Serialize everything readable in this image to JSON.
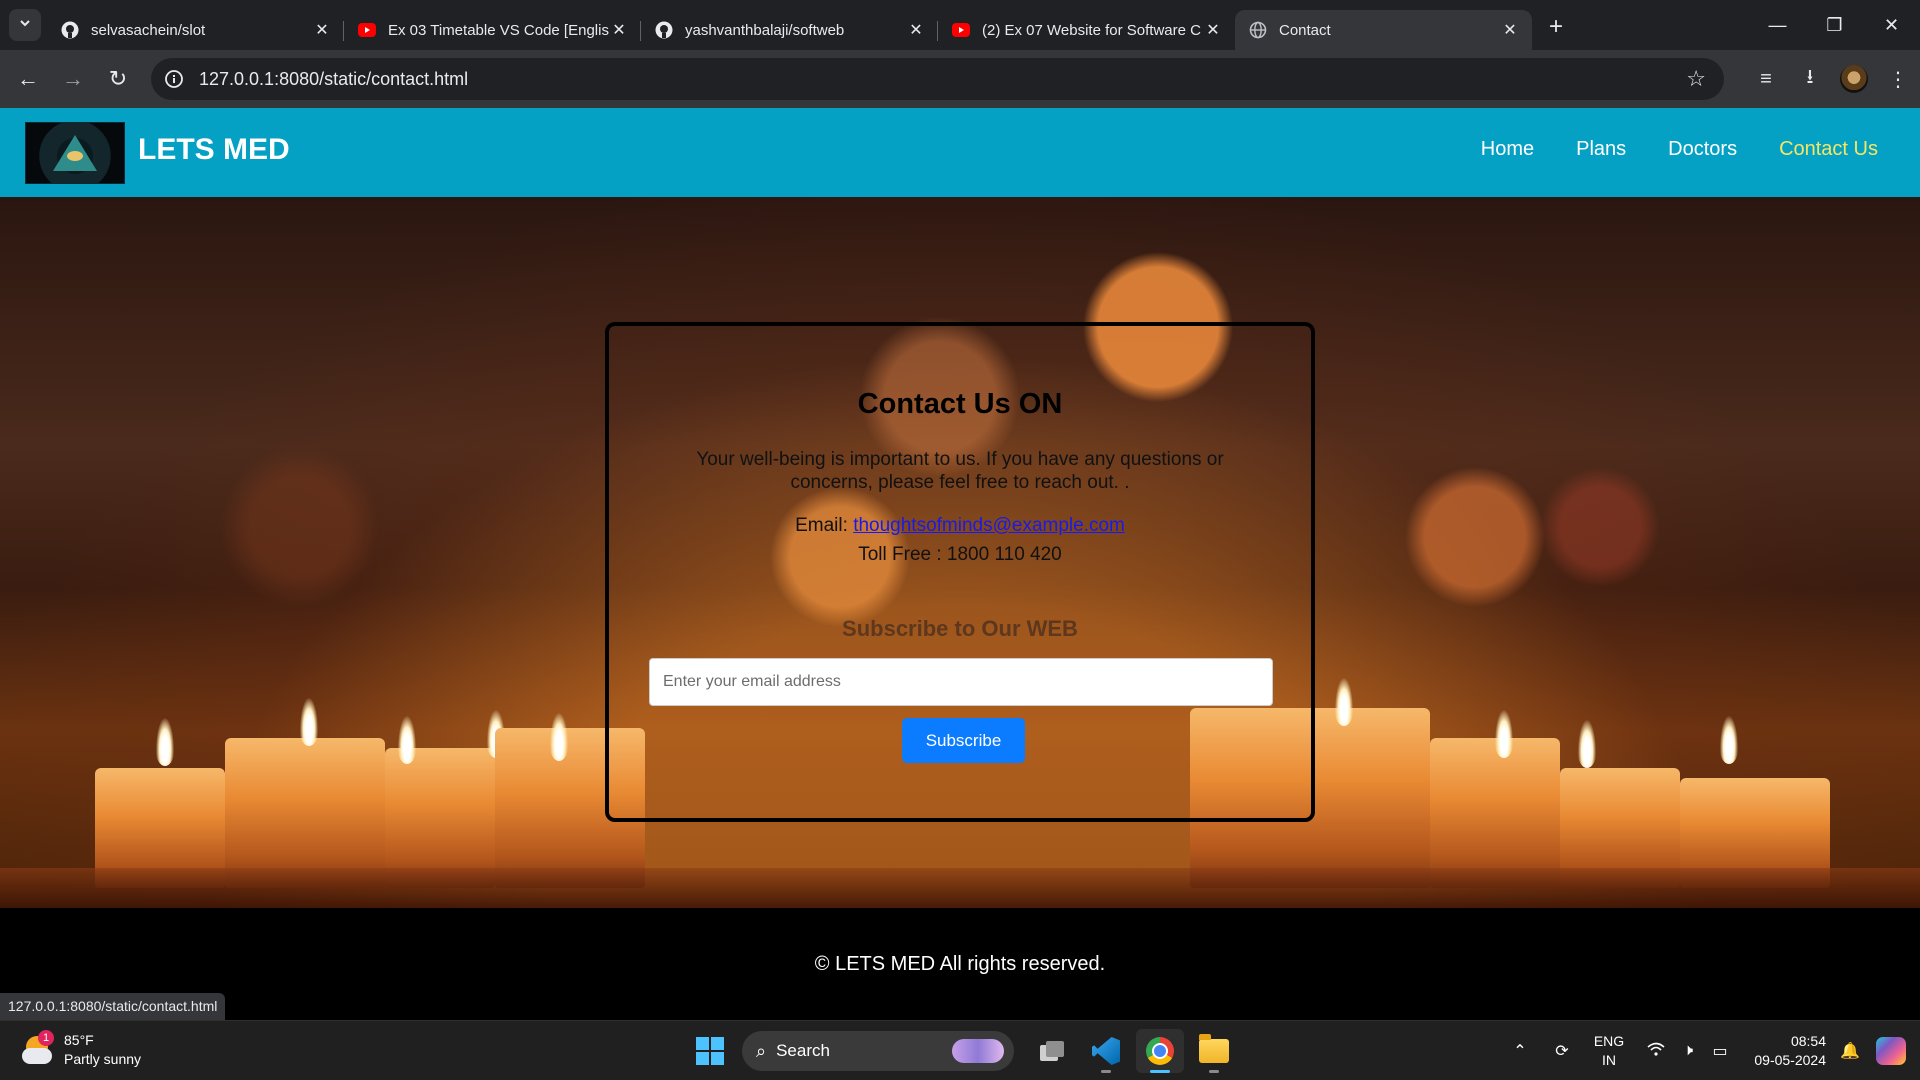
{
  "browser": {
    "tabs": [
      {
        "title": "selvasachein/slot",
        "favicon": "github-icon",
        "active": false
      },
      {
        "title": "Ex 03 Timetable VS Code [English",
        "favicon": "youtube-icon",
        "active": false
      },
      {
        "title": "yashvanthbalaji/softweb",
        "favicon": "github-icon",
        "active": false
      },
      {
        "title": "(2) Ex 07 Website for Software C",
        "favicon": "youtube-icon",
        "active": false
      },
      {
        "title": "Contact",
        "favicon": "globe-icon",
        "active": true
      }
    ],
    "url": "127.0.0.1:8080/static/contact.html",
    "status_url": "127.0.0.1:8080/static/contact.html"
  },
  "site": {
    "brand": "LETS MED",
    "nav": [
      {
        "label": "Home",
        "current": false
      },
      {
        "label": "Plans",
        "current": false
      },
      {
        "label": "Doctors",
        "current": false
      },
      {
        "label": "Contact Us",
        "current": true
      }
    ],
    "contact": {
      "title": "Contact Us ON",
      "text": "Your well-being is important to us. If you have any questions or concerns, please feel free to reach out. .",
      "email_label": "Email: ",
      "email": "thoughtsofminds@example.com",
      "phone": "Toll Free : 1800 110 420"
    },
    "subscribe": {
      "title": "Subscribe to Our WEB",
      "placeholder": "Enter your email address",
      "button": "Subscribe"
    },
    "footer": "© LETS MED All rights reserved."
  },
  "taskbar": {
    "weather_temp": "85°F",
    "weather_desc": "Partly sunny",
    "weather_badge": "1",
    "search_label": "Search",
    "lang_top": "ENG",
    "lang_bottom": "IN",
    "time": "08:54",
    "date": "09-05-2024"
  },
  "colors": {
    "header_bg": "#05a1c4",
    "nav_current": "#f5e663",
    "subscribe_button": "#0b7bff",
    "link": "#1a1ae8"
  }
}
